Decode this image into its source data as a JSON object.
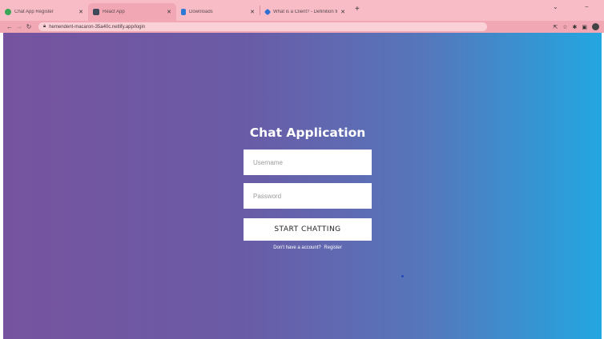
{
  "browser": {
    "tabs": [
      {
        "title": "Chat App Register",
        "favicon_color": "#3aa757",
        "active": false
      },
      {
        "title": "React App",
        "favicon_color": "#3c4a59",
        "active": true
      },
      {
        "title": "Downloads",
        "favicon_color": "#2d7ad6",
        "active": false
      },
      {
        "title": "What is a Client? - Definition fro...",
        "favicon_color": "#2e6fd1",
        "active": false
      }
    ],
    "close_glyph": "✕",
    "new_tab_glyph": "+",
    "url": "hemendent-macaron-35a40c.netlify.app/login"
  },
  "login": {
    "title": "Chat Application",
    "username_placeholder": "Username",
    "password_placeholder": "Password",
    "button_label": "START CHATTING",
    "register_prompt": "Don't have a account?",
    "register_link": "Register"
  },
  "colors": {
    "tabbar": "#f7bcc6",
    "gradient_start": "#76539f",
    "gradient_end": "#22a7e0"
  }
}
